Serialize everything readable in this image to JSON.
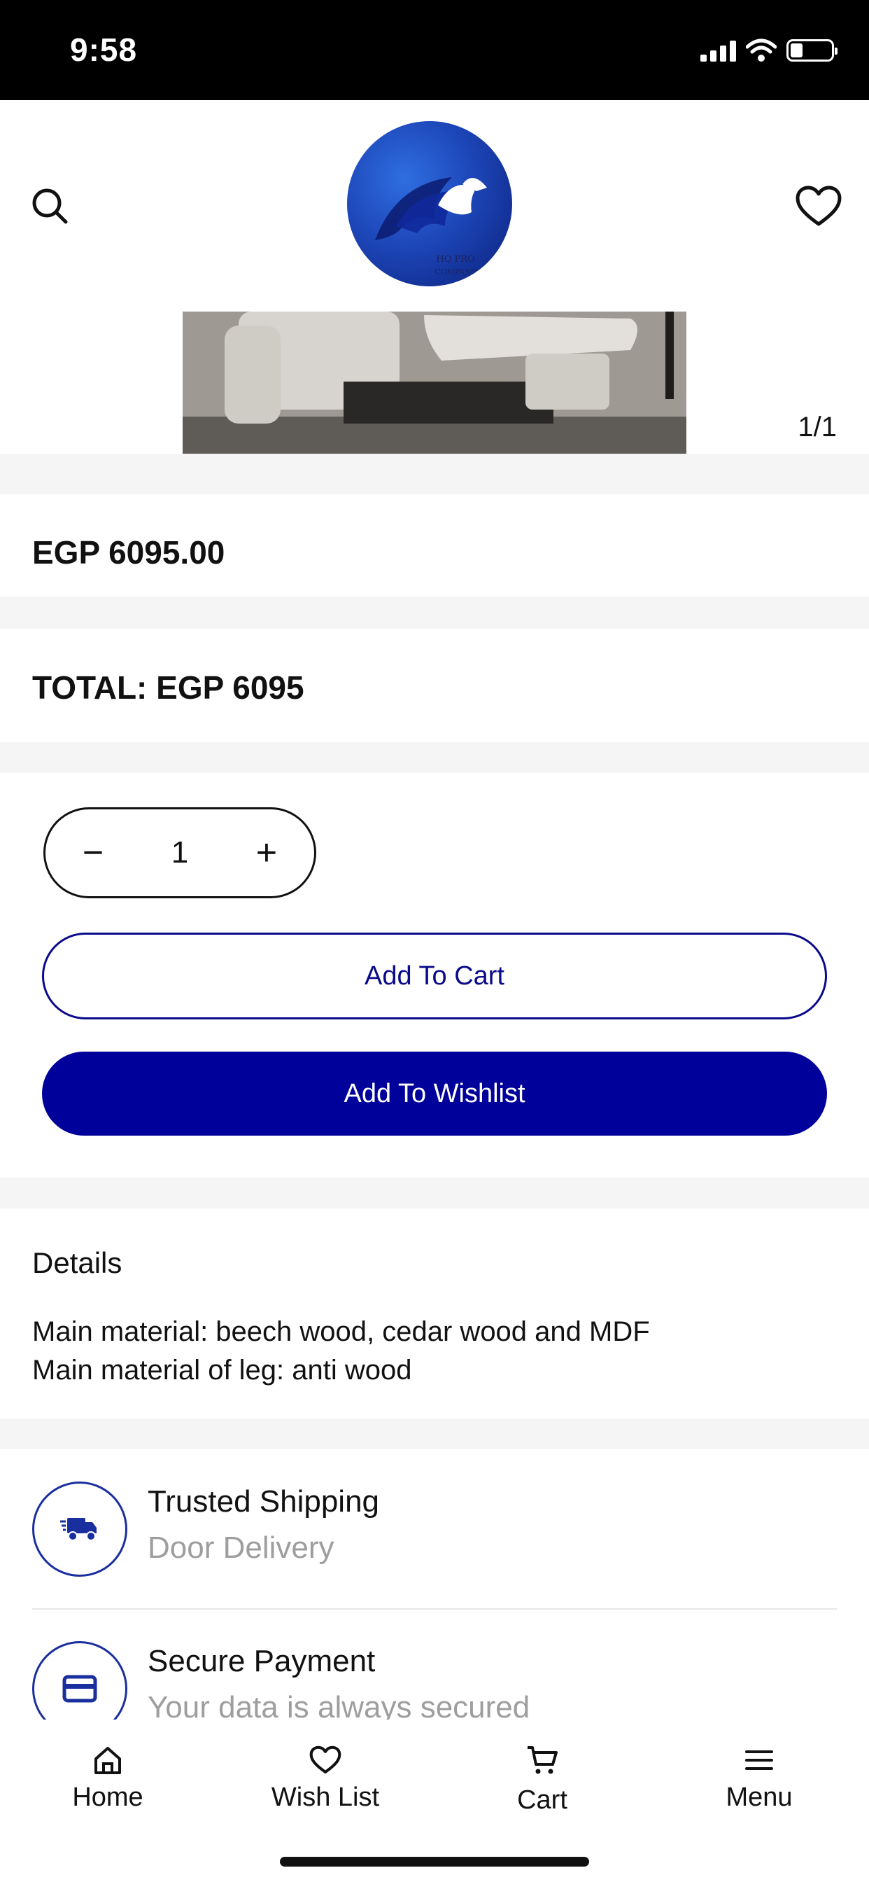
{
  "status_bar": {
    "time": "9:58"
  },
  "header": {
    "logo_line1": "HQ PRO",
    "logo_line2": "COMPANY",
    "search_icon": "search-icon",
    "wishlist_icon": "heart-icon"
  },
  "gallery": {
    "counter": "1/1"
  },
  "product": {
    "price": "EGP 6095.00",
    "total": "TOTAL: EGP 6095"
  },
  "quantity": {
    "minus": "−",
    "value": "1",
    "plus": "+"
  },
  "actions": {
    "add_to_cart": "Add To Cart",
    "add_to_wishlist": "Add To Wishlist"
  },
  "details": {
    "title": "Details",
    "lines": [
      "Main material: beech wood, cedar wood and MDF",
      "Main material of leg: anti wood"
    ]
  },
  "features": [
    {
      "title": "Trusted Shipping",
      "subtitle": "Door Delivery",
      "icon": "truck-icon"
    },
    {
      "title": "Secure Payment",
      "subtitle": "Your data is always secured",
      "icon": "card-icon"
    }
  ],
  "bottom_nav": [
    {
      "label": "Home",
      "icon": "home-icon"
    },
    {
      "label": "Wish List",
      "icon": "heart-icon"
    },
    {
      "label": "Cart",
      "icon": "cart-icon"
    },
    {
      "label": "Menu",
      "icon": "menu-icon"
    }
  ],
  "colors": {
    "brand_navy": "#00009A",
    "outline_blue": "#0A0A8A",
    "muted_text": "#9E9E9E",
    "section_gap": "#F5F5F6"
  }
}
